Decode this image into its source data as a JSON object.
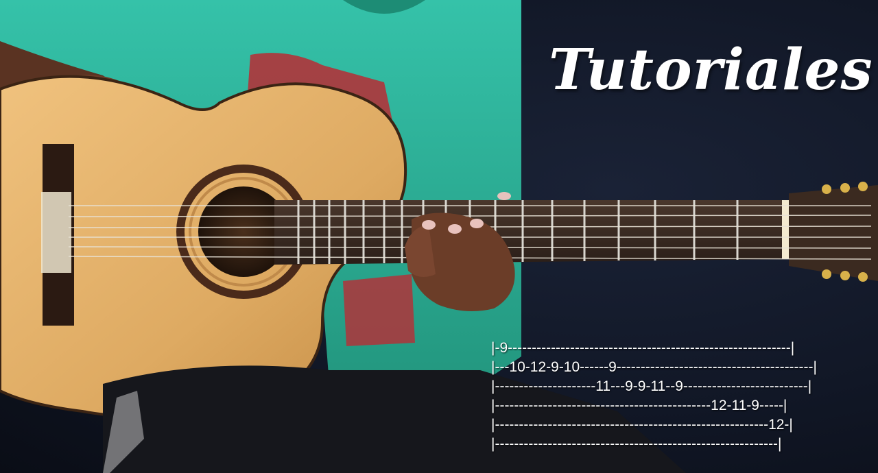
{
  "overlay": {
    "title": "Tutoriales"
  },
  "tablature": {
    "lines": [
      "|-9-----------------------------------------------------------|",
      "|---10-12-9-10------9-----------------------------------------|",
      "|---------------------11---9-9-11--9--------------------------|",
      "|---------------------------------------------12-11-9-----|",
      "|---------------------------------------------------------12-|",
      "|-----------------------------------------------------------|"
    ]
  },
  "colors": {
    "background": "#111726",
    "shirt": "#2fb8a0",
    "guitar_top": "#e2b06a",
    "fretboard": "#3a2a22",
    "text": "#ffffff"
  },
  "icons": [
    "guitar-image",
    "performer-image"
  ]
}
